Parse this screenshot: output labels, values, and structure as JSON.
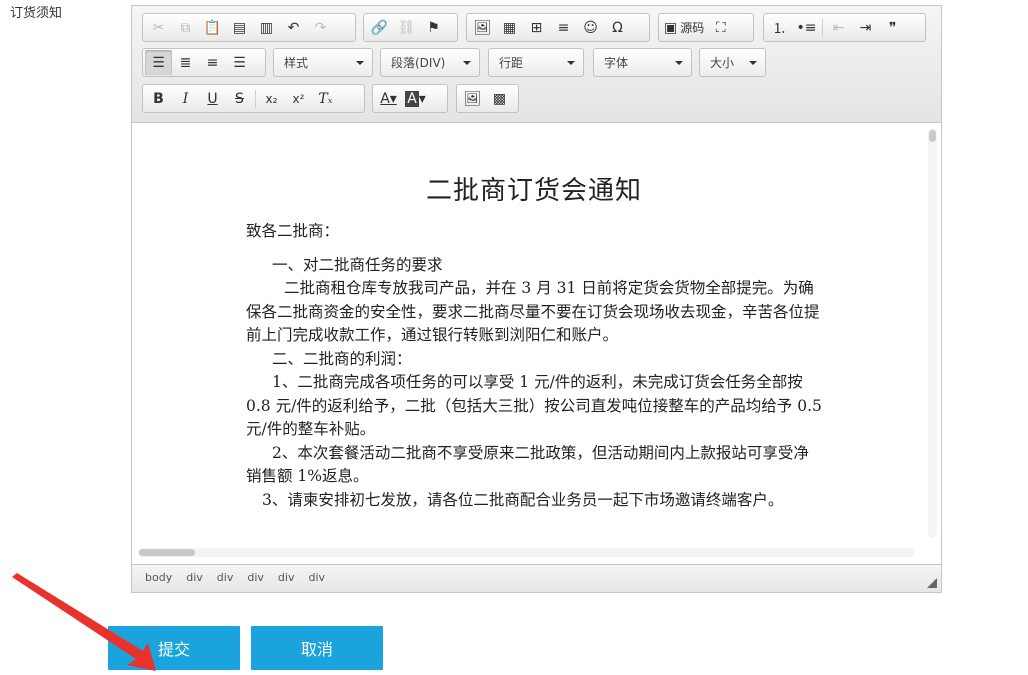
{
  "form": {
    "label": "订货须知"
  },
  "toolbar": {
    "source_label": "源码",
    "combos": {
      "style": "样式",
      "paragraph": "段落(DIV)",
      "line_spacing": "行距",
      "font": "字体",
      "size": "大小"
    }
  },
  "document": {
    "title": "二批商订货会通知",
    "greeting": "致各二批商：",
    "paragraphs": [
      "一、对二批商任务的要求",
      "二批商租仓库专放我司产品，并在 3 月 31 日前将定货会货物全部提完。为确保各二批商资金的安全性，要求二批商尽量不要在订货会现场收去现金，辛苦各位提前上门完成收款工作，通过银行转账到浏阳仁和账户。",
      "二、二批商的利润：",
      "1、二批商完成各项任务的可以享受 1 元/件的返利，未完成订货会任务全部按 0.8 元/件的返利给予，二批（包括大三批）按公司直发吨位接整车的产品均给予 0.5 元/件的整车补贴。",
      "2、本次套餐活动二批商不享受原来二批政策，但活动期间内上款报站可享受净销售额 1%返息。",
      "3、请柬安排初七发放，请各位二批商配合业务员一起下市场邀请终端客户。"
    ]
  },
  "statusbar": {
    "path": [
      "body",
      "div",
      "div",
      "div",
      "div",
      "div"
    ]
  },
  "actions": {
    "submit": "提交",
    "cancel": "取消"
  },
  "colors": {
    "button": "#1aa3dd",
    "arrow": "#e8322b"
  }
}
